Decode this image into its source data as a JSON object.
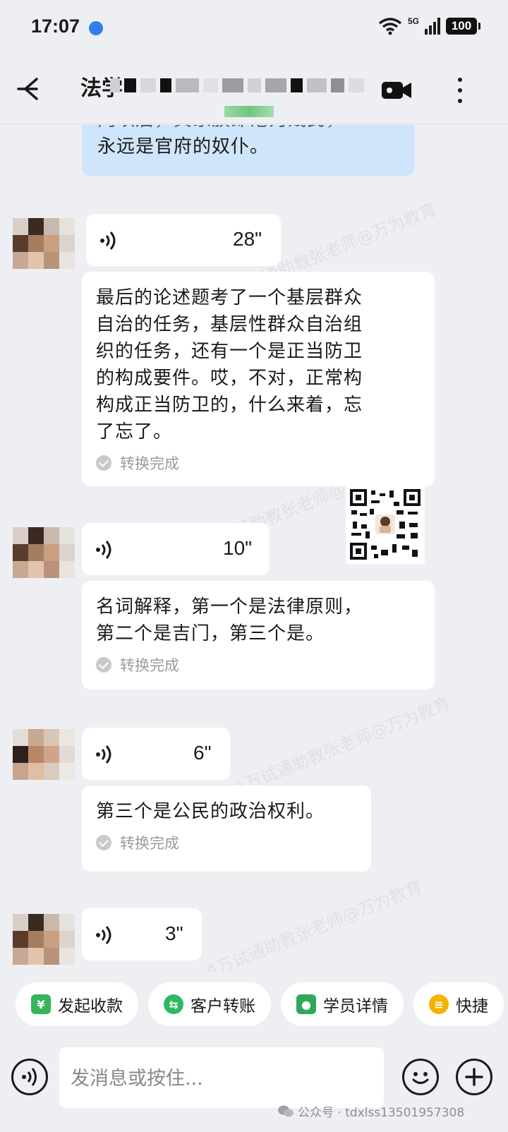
{
  "status_bar": {
    "time": "17:07",
    "network": "5G",
    "battery": "100"
  },
  "header": {
    "title": "法学"
  },
  "messages": [
    {
      "type": "text",
      "from": "self",
      "lines": [
        "门以后，其家族即沦为贱民，",
        "永远是官府的奴仆。"
      ]
    },
    {
      "type": "voice",
      "duration": "28\""
    },
    {
      "type": "transcript",
      "lines": [
        "最后的论述题考了一个基层群众",
        "自治的任务，基层性群众自治组",
        "织的任务，还有一个是正当防卫",
        "的构成要件。哎，不对，正常构",
        "构成正当防卫的，什么来着，忘",
        "了忘了。"
      ],
      "status": "转换完成"
    },
    {
      "type": "voice",
      "duration": "10\""
    },
    {
      "type": "transcript",
      "lines": [
        "名词解释，第一个是法律原则，",
        "第二个是吉门，第三个是。"
      ],
      "status": "转换完成"
    },
    {
      "type": "voice",
      "duration": "6\""
    },
    {
      "type": "transcript",
      "lines": [
        "第三个是公民的政治权利。"
      ],
      "status": "转换完成"
    },
    {
      "type": "voice",
      "duration": "3\""
    }
  ],
  "watermark_text": "A万试通助教张老师@万为教育",
  "quick_actions": [
    {
      "label": "发起收款",
      "color": "#37b45a",
      "icon": "payment-icon"
    },
    {
      "label": "客户转账",
      "color": "#2fb863",
      "icon": "transfer-icon"
    },
    {
      "label": "学员详情",
      "color": "#2fa85a",
      "icon": "student-icon"
    },
    {
      "label": "快捷",
      "color": "#f5b100",
      "icon": "quick-reply-icon"
    }
  ],
  "input": {
    "placeholder": "发消息或按住..."
  },
  "footer_mark": "公众号 · tdxlss13501957308"
}
